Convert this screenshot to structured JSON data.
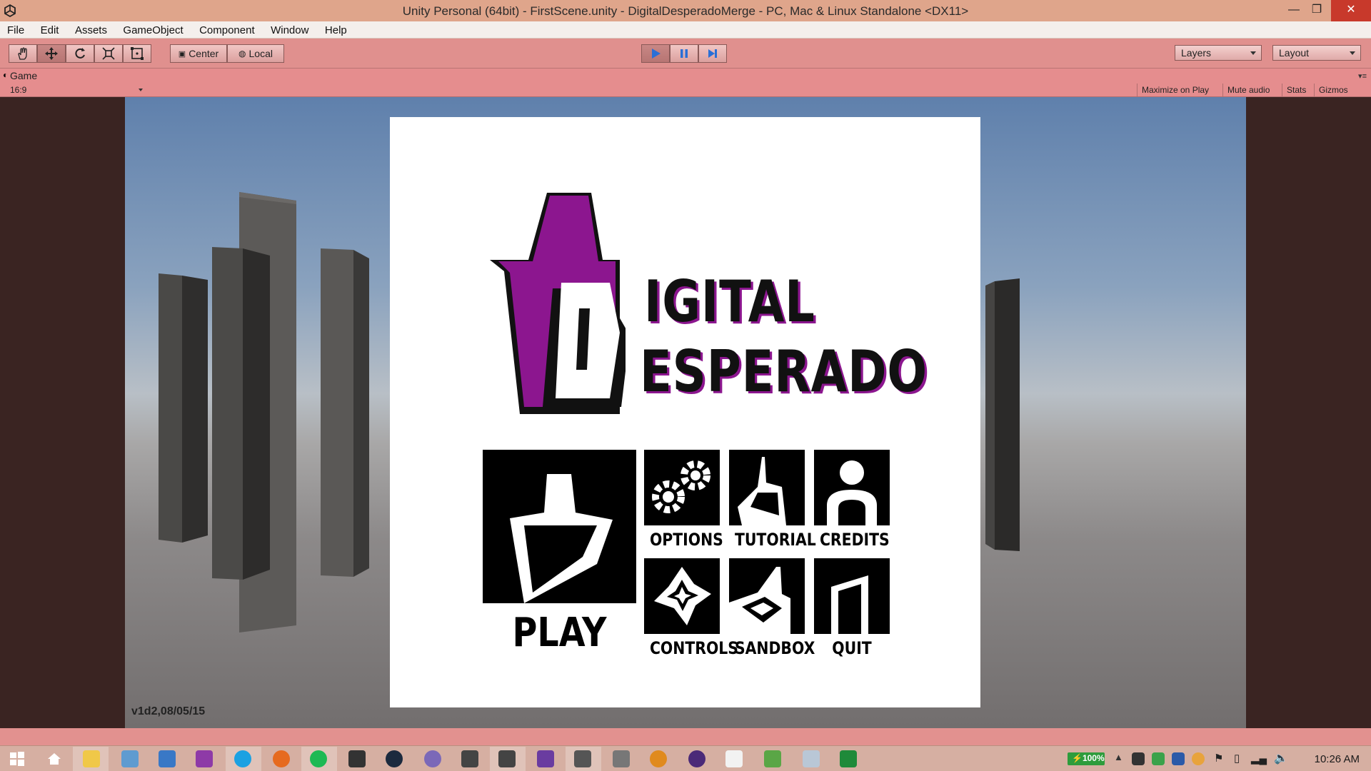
{
  "window": {
    "title": "Unity Personal (64bit) - FirstScene.unity - DigitalDesperadoMerge - PC, Mac & Linux Standalone <DX11>",
    "minimize": "—",
    "restore": "❐",
    "close": "✕"
  },
  "menu": [
    "File",
    "Edit",
    "Assets",
    "GameObject",
    "Component",
    "Window",
    "Help"
  ],
  "toolbar": {
    "tools": [
      "hand-icon",
      "move-icon",
      "rotate-icon",
      "scale-icon",
      "rect-icon"
    ],
    "pivot_label": "Center",
    "space_label": "Local",
    "layers_label": "Layers",
    "layout_label": "Layout",
    "play_state": "playing"
  },
  "game_panel": {
    "tab_label": "Game",
    "aspect": "16:9",
    "maximize_label": "Maximize on Play",
    "mute_label": "Mute audio",
    "stats_label": "Stats",
    "gizmos_label": "Gizmos"
  },
  "game": {
    "version": "v1d2,08/05/15",
    "logo_line1": "IGITAL",
    "logo_line2": "ESPERADO",
    "buttons": {
      "play": "PLAY",
      "options": "OPTIONS",
      "tutorial": "TUTORIAL",
      "credits": "CREDITS",
      "controls": "CONTROLS",
      "sandbox": "SANDBOX",
      "quit": "QUIT"
    },
    "accent_color": "#8c168f"
  },
  "taskbar": {
    "battery": "100%",
    "clock": "10:26 AM"
  }
}
